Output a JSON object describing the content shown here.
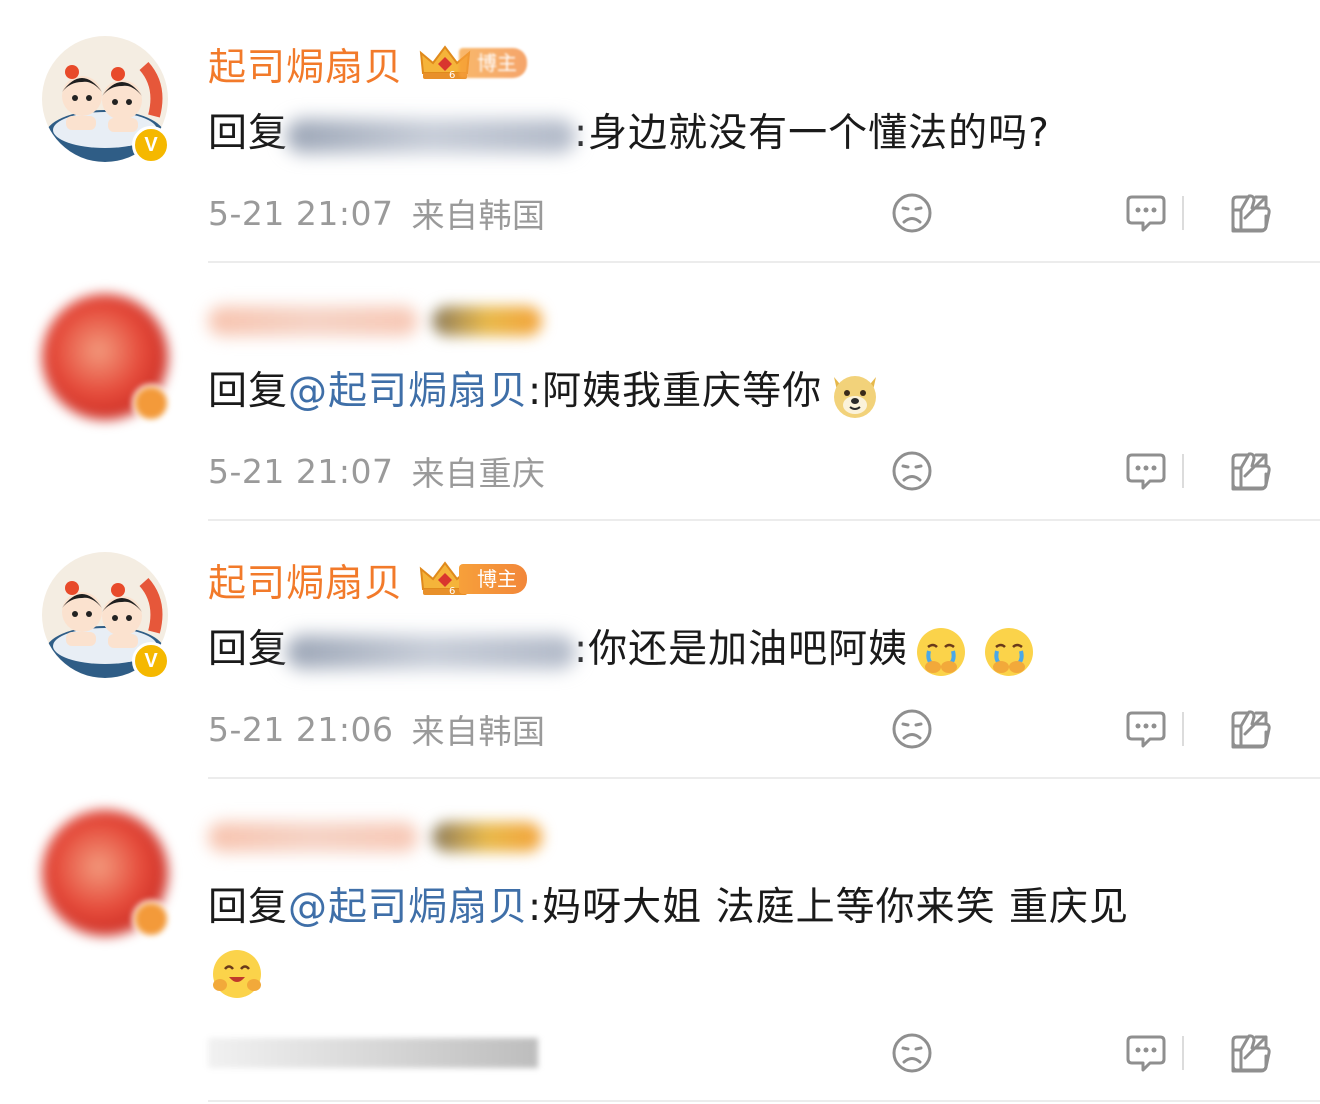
{
  "comments": [
    {
      "username": "起司焗扇贝",
      "badge_label": "博主",
      "reply_prefix": "回复",
      "mention": "",
      "text": ":身边就没有一个懂法的吗?",
      "time": "5-21 21:07",
      "location": "来自韩国",
      "verified": "V"
    },
    {
      "username": "",
      "badge_label": "",
      "reply_prefix": "回复",
      "mention": "@起司焗扇贝",
      "text": ":阿姨我重庆等你",
      "time": "5-21 21:07",
      "location": "来自重庆",
      "emoji": "doge-emoji"
    },
    {
      "username": "起司焗扇贝",
      "badge_label": "博主",
      "reply_prefix": "回复",
      "mention": "",
      "text": ":你还是加油吧阿姨",
      "time": "5-21 21:06",
      "location": "来自韩国",
      "verified": "V",
      "emoji": "crying-emoji"
    },
    {
      "username": "",
      "badge_label": "",
      "reply_prefix": "回复",
      "mention": "@起司焗扇贝",
      "text": ":妈呀大姐 法庭上等你来笑 重庆见",
      "time": "",
      "location": "",
      "emoji": "hug-emoji"
    }
  ],
  "actions": {
    "dislike_icon": "sad-face-icon",
    "share_icon": "share-icon",
    "reply_icon": "comment-icon",
    "like_icon": "thumbs-up-icon"
  },
  "colors": {
    "username": "#f27a2a",
    "mention": "#3f6fa8",
    "meta": "#9a9a9a",
    "badge": "#f2873a"
  }
}
